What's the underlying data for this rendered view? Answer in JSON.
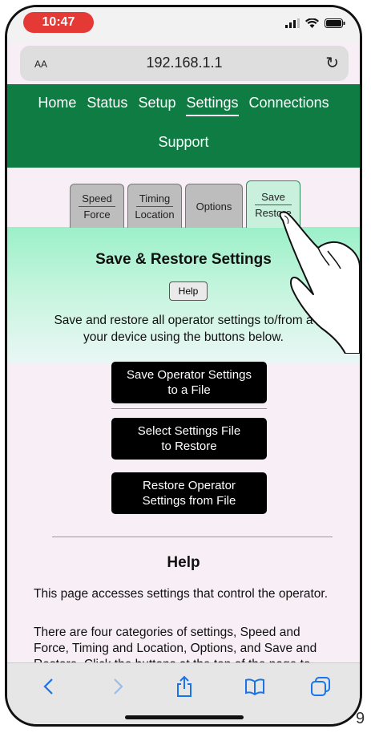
{
  "statusbar": {
    "time": "10:47"
  },
  "browser": {
    "text_size_label": "AA",
    "url": "192.168.1.1",
    "reload_glyph": "↻"
  },
  "nav": {
    "items": [
      "Home",
      "Status",
      "Setup",
      "Settings",
      "Connections"
    ],
    "second_row": "Support",
    "active": "Settings"
  },
  "tabs": [
    {
      "line1": "Speed",
      "line2": "Force"
    },
    {
      "line1": "Timing",
      "line2": "Location"
    },
    {
      "line1": "Options",
      "line2": ""
    },
    {
      "line1": "Save",
      "line2": "Restore"
    }
  ],
  "panel": {
    "title": "Save & Restore Settings",
    "help_button": "Help",
    "description_line1": "Save and restore all operator settings to/from a",
    "description_line2": "your device using the buttons below."
  },
  "buttons": {
    "save": {
      "line1": "Save Operator Settings",
      "line2": "to a File"
    },
    "select": {
      "line1": "Select Settings File",
      "line2": "to Restore"
    },
    "restore": {
      "line1": "Restore Operator",
      "line2": "Settings from File"
    }
  },
  "help": {
    "title": "Help",
    "para1": "This page accesses settings that control the operator.",
    "para2": "There are four categories of settings, Speed and Force, Timing and Location, Options, and Save and Restore. Click the buttons at the top of the page to"
  },
  "edge_text": "9",
  "colors": {
    "nav_green": "#0f7d43",
    "time_pill": "#e53935",
    "link_blue": "#1a73e8"
  },
  "toolbar_icons": [
    "back-icon",
    "forward-icon",
    "share-icon",
    "bookmarks-icon",
    "tabs-icon"
  ]
}
